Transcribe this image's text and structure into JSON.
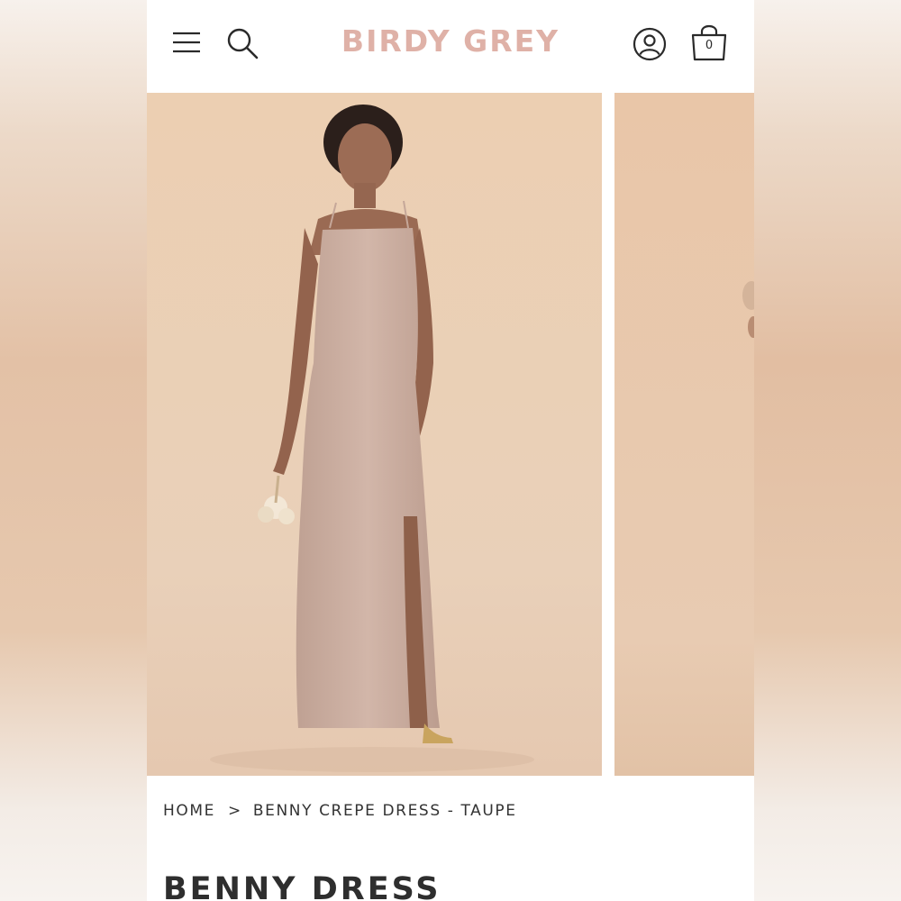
{
  "header": {
    "brand": "BIRDY GREY",
    "menu_icon": "hamburger-menu-icon",
    "search_icon": "search-icon",
    "account_icon": "user-account-icon",
    "cart_icon": "shopping-bag-icon",
    "cart_count": "0"
  },
  "gallery": {
    "images": [
      {
        "subject": "model wearing taupe slip dress holding bouquet"
      },
      {
        "subject": "next product image partially visible"
      }
    ]
  },
  "breadcrumb": {
    "home": "HOME",
    "separator": ">",
    "current": "BENNY CREPE DRESS - TAUPE"
  },
  "product": {
    "title": "BENNY DRESS"
  },
  "colors": {
    "brand": "#dfb1a7",
    "photo_background": "#e9cfb4",
    "dress": "#cdb0a3",
    "text": "#2e2e2e"
  }
}
